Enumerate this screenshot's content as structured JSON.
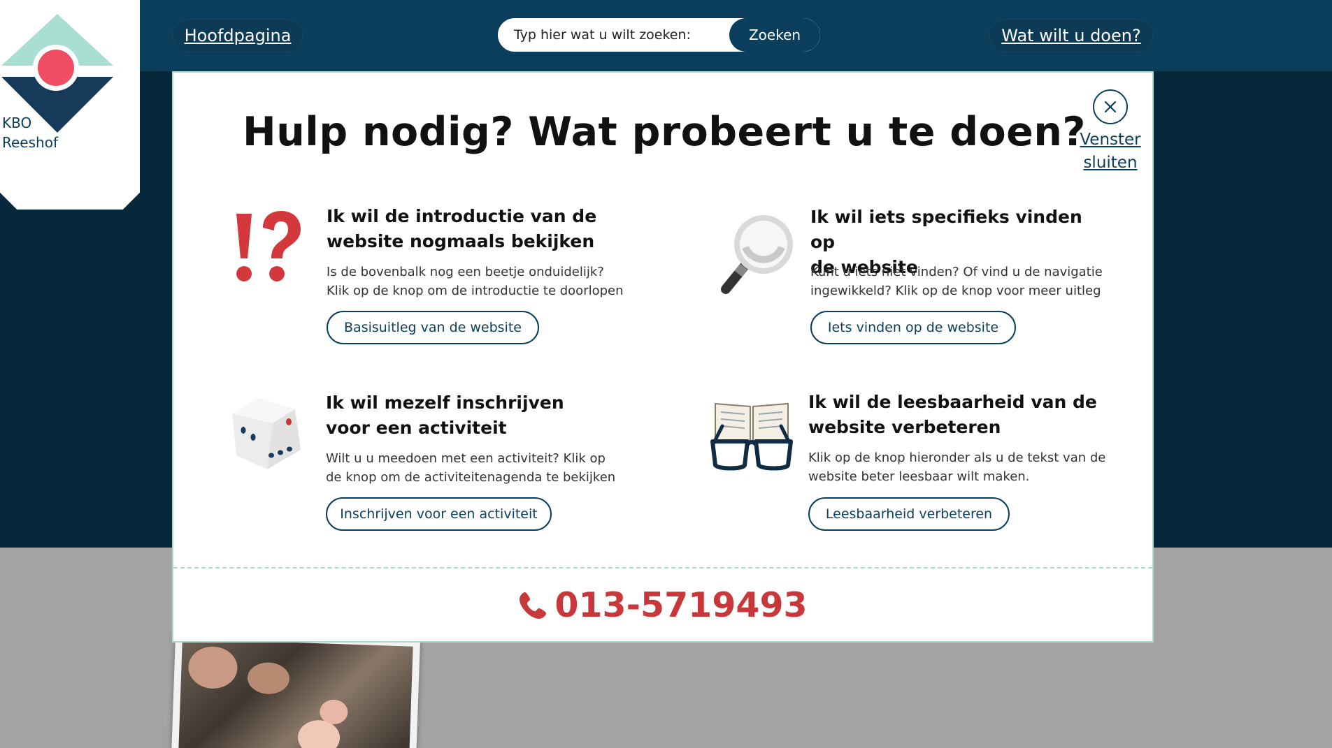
{
  "site": {
    "logo_line1": "KBO",
    "logo_line2": "Reeshof"
  },
  "topbar": {
    "home_link": "Hoofdpagina",
    "search_placeholder": "Typ hier wat u wilt zoeken:",
    "search_button": "Zoeken",
    "help_link": "Wat wilt u doen?"
  },
  "modal": {
    "title": "Hulp nodig? Wat probeert u te doen?",
    "close_line1": "Venster",
    "close_line2": "sluiten",
    "cards": [
      {
        "icon": "exclamation-question-icon",
        "title_line1": "Ik wil de introductie van de",
        "title_line2": "website nogmaals bekijken",
        "desc_line1": "Is de bovenbalk nog een beetje onduidelijk?",
        "desc_line2": "Klik op de knop om de introductie te doorlopen",
        "button": "Basisuitleg van de website"
      },
      {
        "icon": "magnifier-icon",
        "title_line1": "Ik wil iets specifieks vinden op",
        "title_line2": "de website",
        "desc_line1": "Kunt u iets niet vinden? Of vind u de navigatie",
        "desc_line2": "ingewikkeld? Klik op de knop voor meer uitleg",
        "button": "Iets vinden op de website"
      },
      {
        "icon": "dice-icon",
        "title_line1": "Ik wil mezelf inschrijven",
        "title_line2": "voor een activiteit",
        "desc_line1": "Wilt u u meedoen met een activiteit? Klik op",
        "desc_line2": "de knop om de activiteitenagenda te bekijken",
        "button": "Inschrijven voor een activiteit"
      },
      {
        "icon": "book-glasses-icon",
        "title_line1": "Ik wil de leesbaarheid van de",
        "title_line2": "website verbeteren",
        "desc_line1": "Klik op de knop hieronder als u de tekst van de",
        "desc_line2": "website beter leesbaar wilt maken.",
        "button": "Leesbaarheid verbeteren"
      }
    ],
    "phone": "013-5719493"
  },
  "colors": {
    "navy": "#0b3d5c",
    "dark_hero": "#07273a",
    "accent_red": "#c8373a",
    "mint": "#a8dccf"
  }
}
